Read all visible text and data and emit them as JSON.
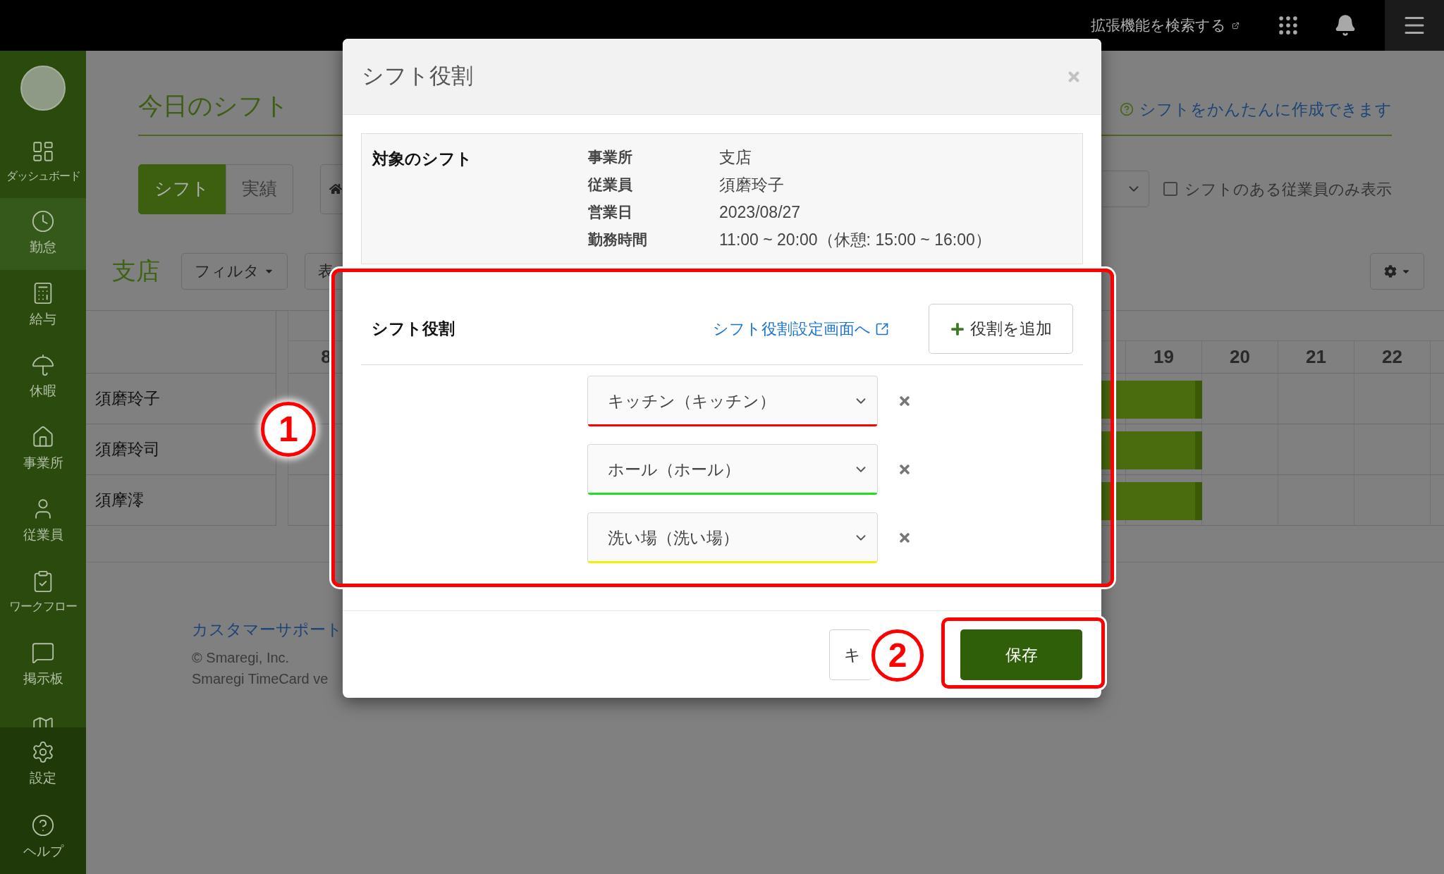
{
  "top_bar": {
    "extension_search": "拡張機能を検索する"
  },
  "sidebar": {
    "items": [
      {
        "label": "ダッシュボード",
        "selected": false
      },
      {
        "label": "勤怠",
        "selected": true
      },
      {
        "label": "給与",
        "selected": false
      },
      {
        "label": "休暇",
        "selected": false
      },
      {
        "label": "事業所",
        "selected": false
      },
      {
        "label": "従業員",
        "selected": false
      },
      {
        "label": "ワークフロー",
        "selected": false
      },
      {
        "label": "掲示板",
        "selected": false
      }
    ],
    "bottom_items": [
      {
        "label": "設定"
      },
      {
        "label": "ヘルプ"
      }
    ]
  },
  "page": {
    "title": "今日のシフト",
    "help_link": "シフトをかんたんに作成できます",
    "view_tabs": [
      {
        "label": "シフト",
        "selected": true
      },
      {
        "label": "実績",
        "selected": false
      }
    ],
    "only_with_shift": {
      "label": "シフトのある従業員のみ表示",
      "checked": false
    },
    "store_name": "支店",
    "filter_button": "フィルタ",
    "display_button": "表",
    "hours": [
      {
        "label": "8"
      },
      {
        "label": "19"
      },
      {
        "label": "20"
      },
      {
        "label": "21"
      },
      {
        "label": "22"
      }
    ],
    "employees": [
      {
        "name": "須磨玲子"
      },
      {
        "name": "須磨玲司"
      },
      {
        "name": "須摩澪"
      }
    ],
    "footer": {
      "support_link": "カスタマーサポート",
      "copyright": "© Smaregi, Inc.",
      "version": "Smaregi TimeCard ve"
    }
  },
  "modal": {
    "title": "シフト役割",
    "info": {
      "heading": "対象のシフト",
      "rows": [
        {
          "label": "事業所",
          "value": "支店"
        },
        {
          "label": "従業員",
          "value": "須磨玲子"
        },
        {
          "label": "営業日",
          "value": "2023/08/27"
        },
        {
          "label": "勤務時間",
          "value": "11:00 ~ 20:00（休憩: 15:00 ~ 16:00）"
        }
      ]
    },
    "roles": {
      "heading": "シフト役割",
      "settings_link": "シフト役割設定画面へ",
      "add_button": "役割を追加",
      "items": [
        {
          "value": "キッチン（キッチン）",
          "color": "#ff0000"
        },
        {
          "value": "ホール（ホール）",
          "color": "#1ee01e"
        },
        {
          "value": "洗い場（洗い場）",
          "color": "#f2f200"
        }
      ]
    },
    "cancel_button": "キ",
    "save_button": "保存"
  },
  "annotations": [
    {
      "label": "1"
    },
    {
      "label": "2"
    }
  ]
}
